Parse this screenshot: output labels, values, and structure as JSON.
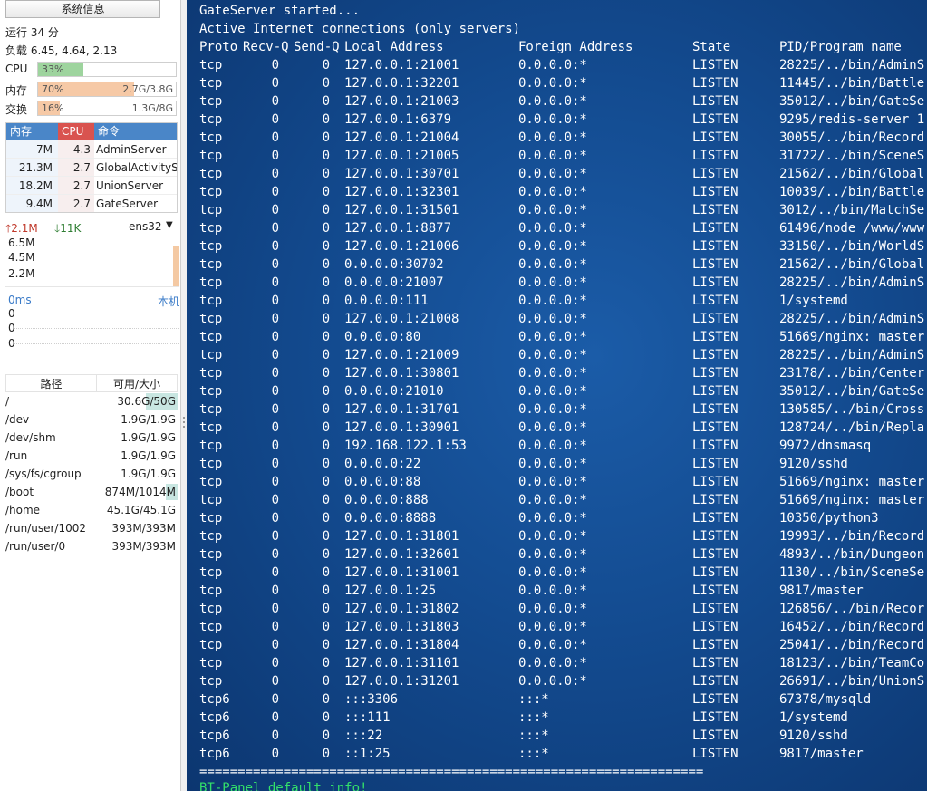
{
  "sidebar": {
    "title_button": "系统信息",
    "uptime": "运行 34 分",
    "load": "负载 6.45, 4.64, 2.13",
    "cpu": {
      "label": "CPU",
      "percent": "33%",
      "value": "",
      "fraction": 0.33,
      "color": "#9ed49e"
    },
    "mem": {
      "label": "内存",
      "percent": "70%",
      "value": "2.7G/3.8G",
      "fraction": 0.7,
      "color": "#f6c9a6"
    },
    "swap": {
      "label": "交换",
      "percent": "16%",
      "value": "1.3G/8G",
      "fraction": 0.16,
      "color": "#f6c9a6"
    },
    "processes": {
      "headers": {
        "mem": "内存",
        "cpu": "CPU",
        "cmd": "命令"
      },
      "rows": [
        {
          "mem": "7M",
          "cpu": "4.3",
          "cmd": "AdminServer"
        },
        {
          "mem": "21.3M",
          "cpu": "2.7",
          "cmd": "GlobalActivityS"
        },
        {
          "mem": "18.2M",
          "cpu": "2.7",
          "cmd": "UnionServer"
        },
        {
          "mem": "9.4M",
          "cpu": "2.7",
          "cmd": "GateServer"
        }
      ]
    },
    "network": {
      "upload": "2.1M",
      "download": "11K",
      "interface": "ens32",
      "scale": [
        "6.5M",
        "4.5M",
        "2.2M"
      ]
    },
    "ping": {
      "label": "0ms",
      "host": "本机",
      "values": [
        "0",
        "0",
        "0"
      ]
    },
    "disks": {
      "headers": {
        "path": "路径",
        "size": "可用/大小"
      },
      "rows": [
        {
          "path": "/",
          "size": "30.6G/50G",
          "used_fraction": 0.39
        },
        {
          "path": "/dev",
          "size": "1.9G/1.9G",
          "used_fraction": 0.0
        },
        {
          "path": "/dev/shm",
          "size": "1.9G/1.9G",
          "used_fraction": 0.0
        },
        {
          "path": "/run",
          "size": "1.9G/1.9G",
          "used_fraction": 0.0
        },
        {
          "path": "/sys/fs/cgroup",
          "size": "1.9G/1.9G",
          "used_fraction": 0.0
        },
        {
          "path": "/boot",
          "size": "874M/1014M",
          "used_fraction": 0.14
        },
        {
          "path": "/home",
          "size": "45.1G/45.1G",
          "used_fraction": 0.0
        },
        {
          "path": "/run/user/1002",
          "size": "393M/393M",
          "used_fraction": 0.0
        },
        {
          "path": "/run/user/0",
          "size": "393M/393M",
          "used_fraction": 0.0
        }
      ]
    }
  },
  "terminal": {
    "line1": "GateServer started...",
    "line2": "Active Internet connections (only servers)",
    "headers": [
      "Proto",
      "Recv-Q",
      "Send-Q",
      "Local Address",
      "Foreign Address",
      "State",
      "PID/Program name"
    ],
    "rows": [
      [
        "tcp",
        "0",
        "0",
        "127.0.0.1:21001",
        "0.0.0.0:*",
        "LISTEN",
        "28225/../bin/AdminS"
      ],
      [
        "tcp",
        "0",
        "0",
        "127.0.0.1:32201",
        "0.0.0.0:*",
        "LISTEN",
        "11445/../bin/Battle"
      ],
      [
        "tcp",
        "0",
        "0",
        "127.0.0.1:21003",
        "0.0.0.0:*",
        "LISTEN",
        "35012/../bin/GateSe"
      ],
      [
        "tcp",
        "0",
        "0",
        "127.0.0.1:6379",
        "0.0.0.0:*",
        "LISTEN",
        "9295/redis-server 1"
      ],
      [
        "tcp",
        "0",
        "0",
        "127.0.0.1:21004",
        "0.0.0.0:*",
        "LISTEN",
        "30055/../bin/Record"
      ],
      [
        "tcp",
        "0",
        "0",
        "127.0.0.1:21005",
        "0.0.0.0:*",
        "LISTEN",
        "31722/../bin/SceneS"
      ],
      [
        "tcp",
        "0",
        "0",
        "127.0.0.1:30701",
        "0.0.0.0:*",
        "LISTEN",
        "21562/../bin/Global"
      ],
      [
        "tcp",
        "0",
        "0",
        "127.0.0.1:32301",
        "0.0.0.0:*",
        "LISTEN",
        "10039/../bin/Battle"
      ],
      [
        "tcp",
        "0",
        "0",
        "127.0.0.1:31501",
        "0.0.0.0:*",
        "LISTEN",
        "3012/../bin/MatchSe"
      ],
      [
        "tcp",
        "0",
        "0",
        "127.0.0.1:8877",
        "0.0.0.0:*",
        "LISTEN",
        "61496/node /www/www"
      ],
      [
        "tcp",
        "0",
        "0",
        "127.0.0.1:21006",
        "0.0.0.0:*",
        "LISTEN",
        "33150/../bin/WorldS"
      ],
      [
        "tcp",
        "0",
        "0",
        "0.0.0.0:30702",
        "0.0.0.0:*",
        "LISTEN",
        "21562/../bin/Global"
      ],
      [
        "tcp",
        "0",
        "0",
        "0.0.0.0:21007",
        "0.0.0.0:*",
        "LISTEN",
        "28225/../bin/AdminS"
      ],
      [
        "tcp",
        "0",
        "0",
        "0.0.0.0:111",
        "0.0.0.0:*",
        "LISTEN",
        "1/systemd"
      ],
      [
        "tcp",
        "0",
        "0",
        "127.0.0.1:21008",
        "0.0.0.0:*",
        "LISTEN",
        "28225/../bin/AdminS"
      ],
      [
        "tcp",
        "0",
        "0",
        "0.0.0.0:80",
        "0.0.0.0:*",
        "LISTEN",
        "51669/nginx: master"
      ],
      [
        "tcp",
        "0",
        "0",
        "127.0.0.1:21009",
        "0.0.0.0:*",
        "LISTEN",
        "28225/../bin/AdminS"
      ],
      [
        "tcp",
        "0",
        "0",
        "127.0.0.1:30801",
        "0.0.0.0:*",
        "LISTEN",
        "23178/../bin/Center"
      ],
      [
        "tcp",
        "0",
        "0",
        "0.0.0.0:21010",
        "0.0.0.0:*",
        "LISTEN",
        "35012/../bin/GateSe"
      ],
      [
        "tcp",
        "0",
        "0",
        "127.0.0.1:31701",
        "0.0.0.0:*",
        "LISTEN",
        "130585/../bin/Cross"
      ],
      [
        "tcp",
        "0",
        "0",
        "127.0.0.1:30901",
        "0.0.0.0:*",
        "LISTEN",
        "128724/../bin/Repla"
      ],
      [
        "tcp",
        "0",
        "0",
        "192.168.122.1:53",
        "0.0.0.0:*",
        "LISTEN",
        "9972/dnsmasq"
      ],
      [
        "tcp",
        "0",
        "0",
        "0.0.0.0:22",
        "0.0.0.0:*",
        "LISTEN",
        "9120/sshd"
      ],
      [
        "tcp",
        "0",
        "0",
        "0.0.0.0:88",
        "0.0.0.0:*",
        "LISTEN",
        "51669/nginx: master"
      ],
      [
        "tcp",
        "0",
        "0",
        "0.0.0.0:888",
        "0.0.0.0:*",
        "LISTEN",
        "51669/nginx: master"
      ],
      [
        "tcp",
        "0",
        "0",
        "0.0.0.0:8888",
        "0.0.0.0:*",
        "LISTEN",
        "10350/python3"
      ],
      [
        "tcp",
        "0",
        "0",
        "127.0.0.1:31801",
        "0.0.0.0:*",
        "LISTEN",
        "19993/../bin/Record"
      ],
      [
        "tcp",
        "0",
        "0",
        "127.0.0.1:32601",
        "0.0.0.0:*",
        "LISTEN",
        "4893/../bin/Dungeon"
      ],
      [
        "tcp",
        "0",
        "0",
        "127.0.0.1:31001",
        "0.0.0.0:*",
        "LISTEN",
        "1130/../bin/SceneSe"
      ],
      [
        "tcp",
        "0",
        "0",
        "127.0.0.1:25",
        "0.0.0.0:*",
        "LISTEN",
        "9817/master"
      ],
      [
        "tcp",
        "0",
        "0",
        "127.0.0.1:31802",
        "0.0.0.0:*",
        "LISTEN",
        "126856/../bin/Recor"
      ],
      [
        "tcp",
        "0",
        "0",
        "127.0.0.1:31803",
        "0.0.0.0:*",
        "LISTEN",
        "16452/../bin/Record"
      ],
      [
        "tcp",
        "0",
        "0",
        "127.0.0.1:31804",
        "0.0.0.0:*",
        "LISTEN",
        "25041/../bin/Record"
      ],
      [
        "tcp",
        "0",
        "0",
        "127.0.0.1:31101",
        "0.0.0.0:*",
        "LISTEN",
        "18123/../bin/TeamCo"
      ],
      [
        "tcp",
        "0",
        "0",
        "127.0.0.1:31201",
        "0.0.0.0:*",
        "LISTEN",
        "26691/../bin/UnionS"
      ],
      [
        "tcp6",
        "0",
        "0",
        ":::3306",
        ":::*",
        "LISTEN",
        "67378/mysqld"
      ],
      [
        "tcp6",
        "0",
        "0",
        ":::111",
        ":::*",
        "LISTEN",
        "1/systemd"
      ],
      [
        "tcp6",
        "0",
        "0",
        ":::22",
        ":::*",
        "LISTEN",
        "9120/sshd"
      ],
      [
        "tcp6",
        "0",
        "0",
        "::1:25",
        ":::*",
        "LISTEN",
        "9817/master"
      ]
    ],
    "separator": "==================================================================",
    "footer": "BT-Panel default info!"
  }
}
